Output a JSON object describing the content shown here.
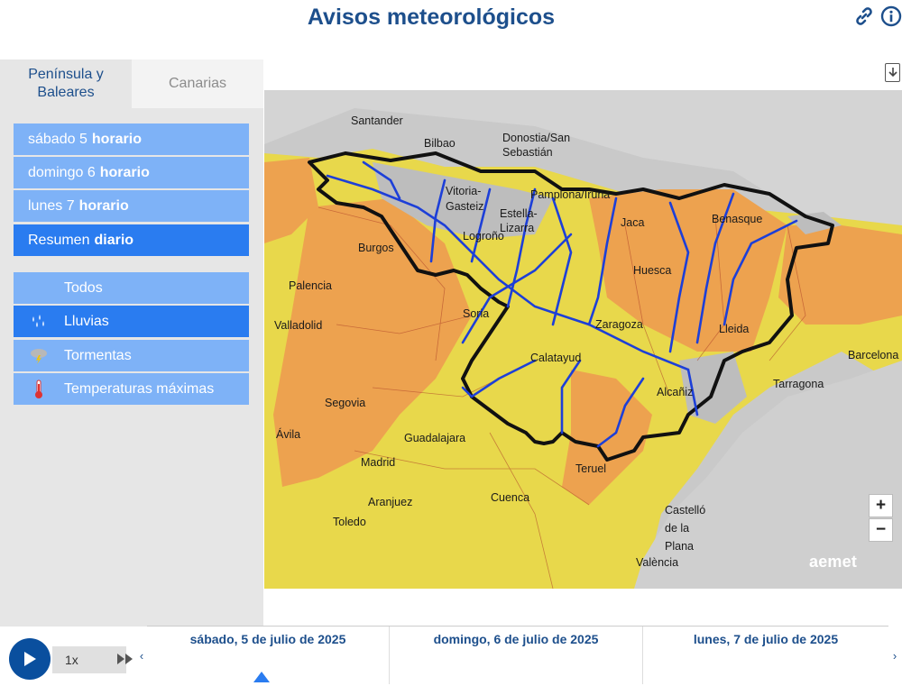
{
  "page": {
    "title": "Avisos meteorológicos",
    "link_icon": "link-icon",
    "info_icon": "info-icon"
  },
  "tabs": [
    {
      "label": "Península y Baleares",
      "active": true
    },
    {
      "label": "Canarias",
      "active": false
    }
  ],
  "days": [
    {
      "day": "sábado 5",
      "mode": "horario",
      "selected": false
    },
    {
      "day": "domingo 6",
      "mode": "horario",
      "selected": false
    },
    {
      "day": "lunes 7",
      "mode": "horario",
      "selected": false
    },
    {
      "day": "Resumen",
      "mode": "diario",
      "selected": true
    }
  ],
  "phenomena": [
    {
      "label": "Todos",
      "icon": "",
      "selected": false
    },
    {
      "label": "Lluvias",
      "icon": "rain-icon",
      "selected": true
    },
    {
      "label": "Tormentas",
      "icon": "storm-icon",
      "selected": false
    },
    {
      "label": "Temperaturas máximas",
      "icon": "thermometer-icon",
      "selected": false
    }
  ],
  "map": {
    "download_icon": "download-icon",
    "zoom_in": "+",
    "zoom_out": "−",
    "logo": "aemet",
    "colors": {
      "yellow": "#e9d94a",
      "orange": "#eea24f",
      "grey": "#c6c6c6",
      "border": "#000000",
      "river": "#1d3fd8"
    },
    "cities": [
      "Santander",
      "Bilbao",
      "Donostia/San Sebastián",
      "Vitoria-Gasteiz",
      "Pamplona/Iruña",
      "Estella-Lizarra",
      "Logroño",
      "Burgos",
      "Jaca",
      "Benasque",
      "Huesca",
      "Palencia",
      "Soria",
      "Valladolid",
      "Zaragoza",
      "Lleida",
      "Barcelona",
      "Calatayud",
      "Tarragona",
      "Alcañiz",
      "Segovia",
      "Ávila",
      "Guadalajara",
      "Madrid",
      "Teruel",
      "Aranjuez",
      "Cuenca",
      "Toledo",
      "Castelló de la Plana",
      "València"
    ]
  },
  "player": {
    "speed": "1x",
    "play_icon": "play-icon",
    "ff_icon": "fast-forward-icon"
  },
  "timeline": {
    "dates": [
      "sábado, 5 de julio de 2025",
      "domingo, 6 de julio de 2025",
      "lunes, 7 de julio de 2025"
    ],
    "prev": "‹",
    "next": "›"
  }
}
